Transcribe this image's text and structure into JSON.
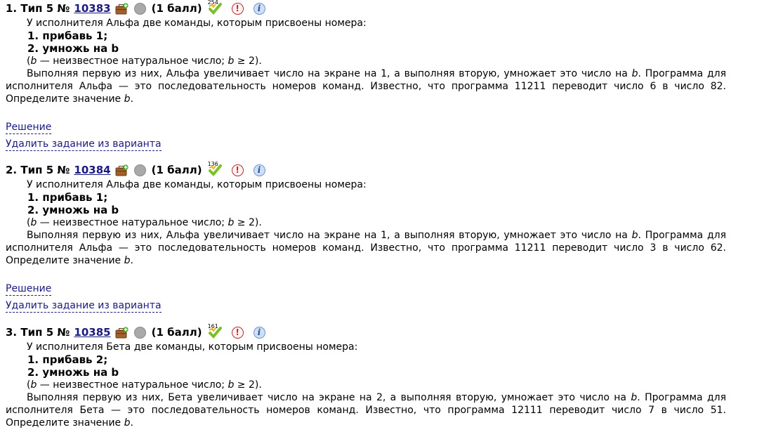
{
  "problems": [
    {
      "index": "1.",
      "type": "Тип 5",
      "no_sign": "№",
      "number": "10383",
      "score": "(1 балл)",
      "solved_count": "254",
      "intro": "У исполнителя Альфа две команды, которым присвоены номера:",
      "cmd1": "1. прибавь 1;",
      "cmd2": "2. умножь на b",
      "note_var": "b",
      "note_rest": " — неизвестное натуральное число; ",
      "note_var2": "b",
      "note_end": " ≥ 2).",
      "note_open": "(",
      "p1": "Выполняя первую из них, Альфа увеличивает число на экране на 1, а выполняя вторую, умножает это число на ",
      "p1_var": "b",
      "p1_end": ". Программа для исполнителя Альфа — это последовательность номеров команд. Известно, что программа 11211 переводит число 6 в число 82. Определите значение ",
      "p1_var2": "b",
      "p1_dot": ".",
      "solution_link": "Решение",
      "remove_link": "Удалить задание из варианта"
    },
    {
      "index": "2.",
      "type": "Тип 5",
      "no_sign": "№",
      "number": "10384",
      "score": "(1 балл)",
      "solved_count": "136",
      "intro": "У исполнителя Альфа две команды, которым присвоены номера:",
      "cmd1": "1. прибавь 1;",
      "cmd2": "2. умножь на b",
      "note_var": "b",
      "note_rest": " — неизвестное натуральное число; ",
      "note_var2": "b",
      "note_end": " ≥ 2).",
      "note_open": "(",
      "p1": "Выполняя первую из них, Альфа увеличивает число на экране на 1, а выполняя вторую, умножает это число на ",
      "p1_var": "b",
      "p1_end": ". Программа для исполнителя Альфа — это последовательность номеров команд. Известно, что программа 11211 переводит число 3 в число 62. Определите значение ",
      "p1_var2": "b",
      "p1_dot": ".",
      "solution_link": "Решение",
      "remove_link": "Удалить задание из варианта"
    },
    {
      "index": "3.",
      "type": "Тип 5",
      "no_sign": "№",
      "number": "10385",
      "score": "(1 балл)",
      "solved_count": "161",
      "intro": "У исполнителя Бета две команды, которым присвоены номера:",
      "cmd1": "1. прибавь 2;",
      "cmd2": "2. умножь на b",
      "note_var": "b",
      "note_rest": " — неизвестное натуральное число; ",
      "note_var2": "b",
      "note_end": " ≥ 2).",
      "note_open": "(",
      "p1": "Выполняя первую из них, Бета увеличивает число на экране на 2, а выполняя вторую, умножает это число на ",
      "p1_var": "b",
      "p1_end": ". Программа для исполнителя Бета — это последовательность номеров команд. Известно, что программа 12111 переводит число 7 в число 51. Определите значение ",
      "p1_var2": "b",
      "p1_dot": "."
    }
  ],
  "icons": {
    "case": "briefcase-plus-icon",
    "status": "status-circle-icon",
    "solved": "solved-count-icon",
    "warn": "report-error-icon",
    "warn_glyph": "!",
    "info": "info-icon",
    "info_glyph": "i"
  },
  "colors": {
    "link": "#1a1a80",
    "warn": "#c0272d",
    "info_bg": "#cfe0f5"
  }
}
